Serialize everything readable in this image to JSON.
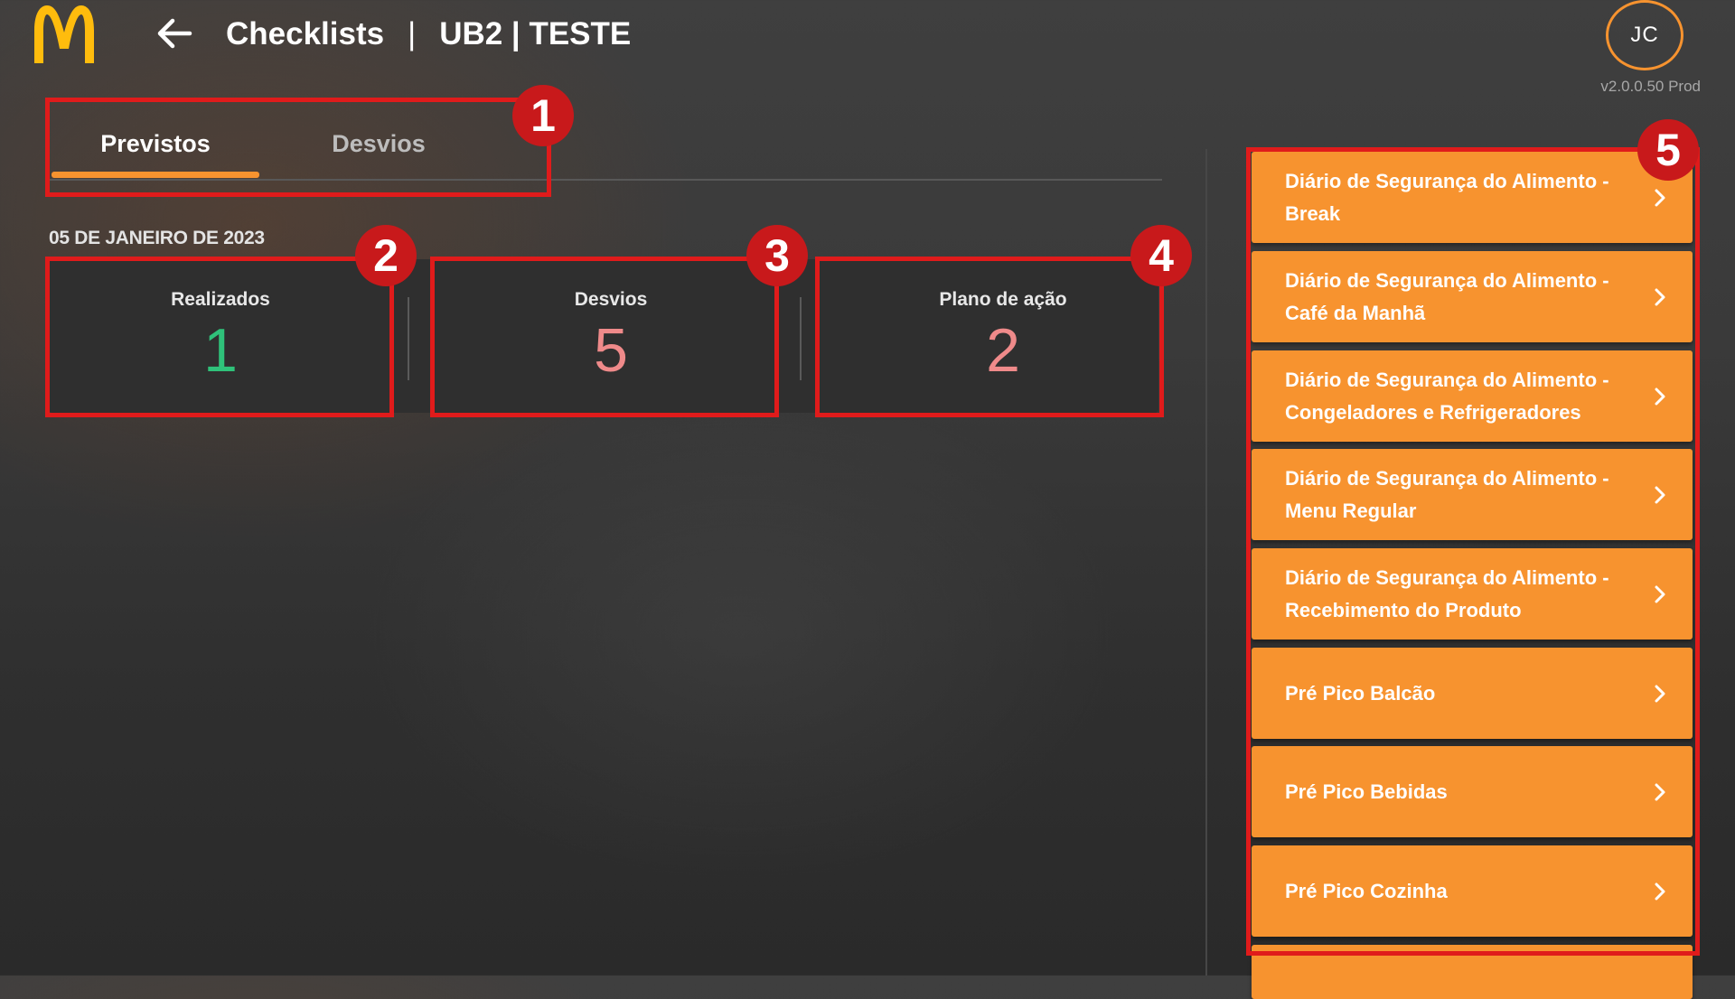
{
  "header": {
    "title": "Checklists",
    "separator": "|",
    "store": "UB2 | TESTE",
    "avatar_initials": "JC",
    "version": "v2.0.0.50 Prod"
  },
  "tabs": [
    {
      "label": "Previstos",
      "active": true
    },
    {
      "label": "Desvios",
      "active": false
    }
  ],
  "date": "05 DE JANEIRO DE 2023",
  "stats": [
    {
      "label": "Realizados",
      "value": "1",
      "color": "#2fc27a"
    },
    {
      "label": "Desvios",
      "value": "5",
      "color": "#ef8a8a"
    },
    {
      "label": "Plano de ação",
      "value": "2",
      "color": "#ef8a8a"
    }
  ],
  "checklists": [
    "Diário de Segurança do Alimento - Break",
    "Diário de Segurança do Alimento - Café da Manhã",
    "Diário de Segurança do Alimento - Congeladores e Refrigeradores",
    "Diário de Segurança do Alimento - Menu Regular",
    "Diário de Segurança do Alimento - Recebimento do Produto",
    "Pré Pico Balcão",
    "Pré Pico Bebidas",
    "Pré Pico Cozinha"
  ],
  "annotations": [
    "1",
    "2",
    "3",
    "4",
    "5"
  ],
  "colors": {
    "accent": "#f7932f",
    "annotation": "#e01b1b",
    "logo": "#ffbc0d",
    "done": "#2fc27a",
    "deviation": "#ef8a8a"
  },
  "icons": {
    "logo": "golden-arches-logo",
    "back": "arrow-left-icon",
    "item": "chevron-right-icon"
  }
}
